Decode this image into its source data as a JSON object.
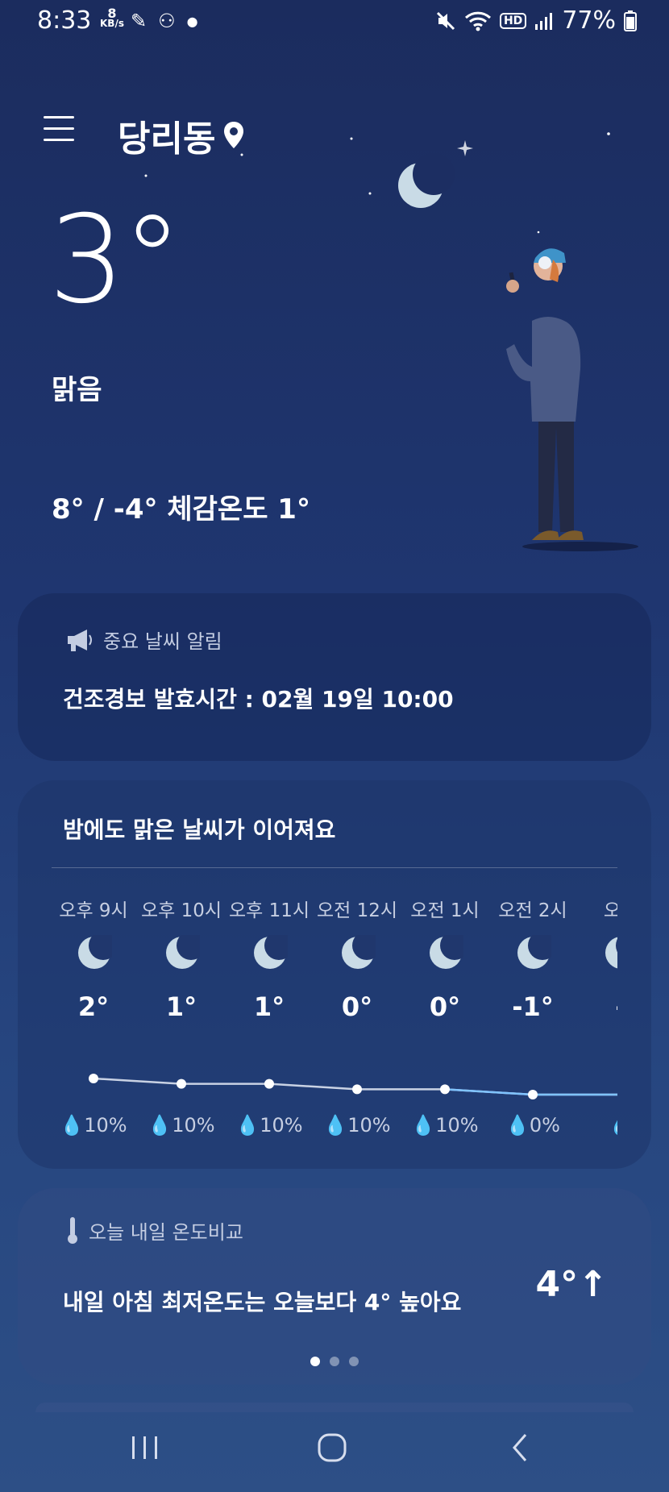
{
  "status_bar": {
    "time": "8:33",
    "net_speed_value": "8",
    "net_speed_unit": "KB/s",
    "battery": "77%"
  },
  "header": {
    "location": "당리동"
  },
  "current": {
    "temperature": "3°",
    "condition": "맑음",
    "minmax_feels": "8° / -4° 체감온도 1°"
  },
  "alert_card": {
    "label": "중요 날씨 알림",
    "message": "건조경보  발효시간 : 02월 19일 10:00"
  },
  "hourly_card": {
    "title": "밤에도 맑은 날씨가 이어져요",
    "hours": [
      {
        "time": "오후 9시",
        "temp": "2°",
        "rain": "10%",
        "icon": "moon-icon"
      },
      {
        "time": "오후 10시",
        "temp": "1°",
        "rain": "10%",
        "icon": "moon-icon"
      },
      {
        "time": "오후 11시",
        "temp": "1°",
        "rain": "10%",
        "icon": "moon-icon"
      },
      {
        "time": "오전 12시",
        "temp": "0°",
        "rain": "10%",
        "icon": "moon-icon"
      },
      {
        "time": "오전 1시",
        "temp": "0°",
        "rain": "10%",
        "icon": "moon-icon"
      },
      {
        "time": "오전 2시",
        "temp": "-1°",
        "rain": "0%",
        "icon": "moon-icon"
      },
      {
        "time": "오전",
        "temp": "-",
        "rain": "",
        "icon": "moon-icon"
      }
    ],
    "line_color": "#7fc3ff"
  },
  "compare_card": {
    "label": "오늘 내일 온도비교",
    "message": "내일 아침 최저온도는 오늘보다 4° 높아요",
    "delta": "4°↑",
    "page_count": 3,
    "active_page": 1
  },
  "colors": {
    "background_top": "#1b2c5e",
    "background_bottom": "#2d4f86",
    "moon": "#c9dbe6"
  }
}
